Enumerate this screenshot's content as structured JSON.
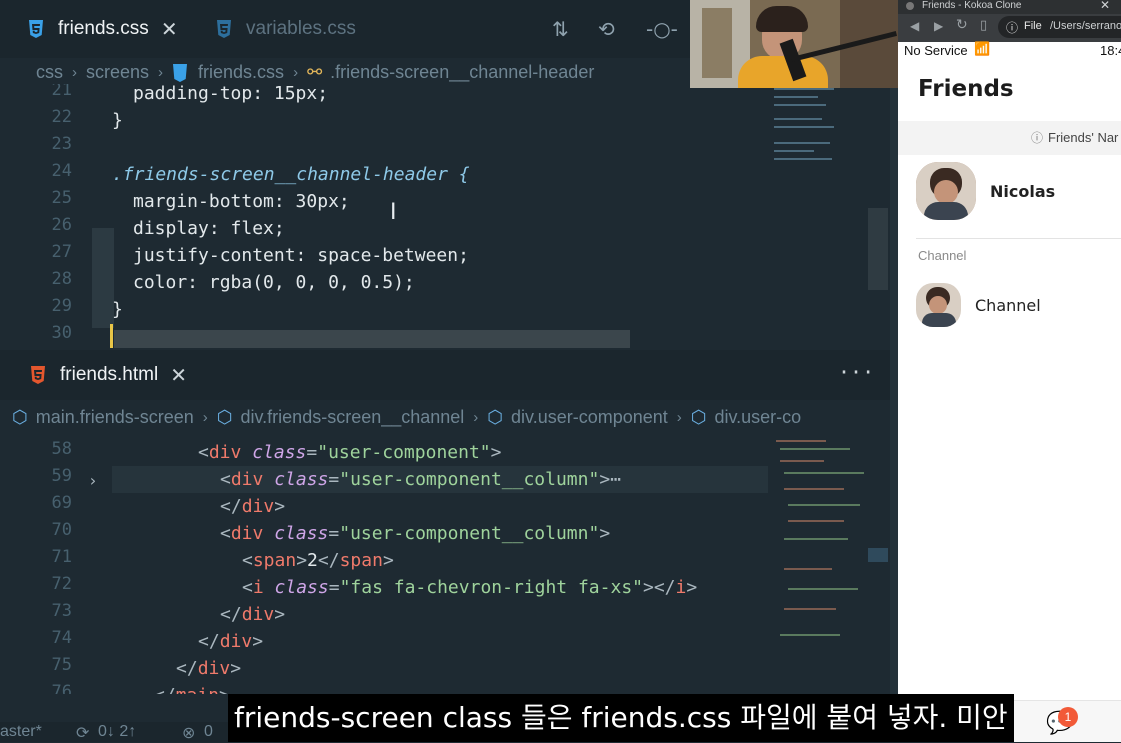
{
  "editor": {
    "top_tabs": [
      {
        "label": "friends.css",
        "active": true
      },
      {
        "label": "variables.css",
        "active": false
      }
    ],
    "top_breadcrumb": [
      "css",
      "screens",
      "friends.css",
      ".friends-screen__channel-header"
    ],
    "css_lines": [
      {
        "n": "21",
        "text": "padding-top: 15px;"
      },
      {
        "n": "22",
        "text": "}"
      },
      {
        "n": "23",
        "text": ""
      },
      {
        "n": "24",
        "text": ".friends-screen__channel-header {"
      },
      {
        "n": "25",
        "text": "margin-bottom: 30px;"
      },
      {
        "n": "26",
        "text": "display: flex;"
      },
      {
        "n": "27",
        "text": "justify-content: space-between;"
      },
      {
        "n": "28",
        "text": "color: rgba(0, 0, 0, 0.5);"
      },
      {
        "n": "29",
        "text": "}"
      },
      {
        "n": "30",
        "text": ""
      }
    ],
    "bottom_tab": "friends.html",
    "bottom_breadcrumb": [
      "main.friends-screen",
      "div.friends-screen__channel",
      "div.user-component",
      "div.user-co"
    ],
    "html_line_numbers": [
      "58",
      "59",
      "69",
      "70",
      "71",
      "72",
      "73",
      "74",
      "75",
      "76"
    ],
    "html_lines": {
      "l58": {
        "class_val": "\"user-component\""
      },
      "l59": {
        "class_val": "\"user-component__column\"",
        "fold": "⋯"
      },
      "l70": {
        "class_val": "\"user-component__column\""
      },
      "l71": {
        "text": "2"
      },
      "l72": {
        "class_val": "\"fas fa-chevron-right fa-xs\""
      }
    },
    "more_label": "···",
    "status_left": "aster*",
    "status_sync": "0↓ 2↑",
    "status_errors": "0"
  },
  "phone": {
    "browser_title": "Friends - Kokoa Clone",
    "address_file": "File",
    "address_path": "/Users/serrano",
    "carrier": "No Service",
    "time": "18:4",
    "page_title": "Friends",
    "notice": "Friends' Nar",
    "me_name": "Nicolas",
    "section_label": "Channel",
    "channel_name": "Channel",
    "chat_badge": "1"
  },
  "subtitle": "friends-screen class 들은 friends.css 파일에 붙여 넣자. 미안",
  "colors": {
    "editor_bg": "#1e2a32",
    "accent_yellow": "#e8c547",
    "css_blue": "#3aa1e8",
    "html_orange": "#e4572e"
  }
}
